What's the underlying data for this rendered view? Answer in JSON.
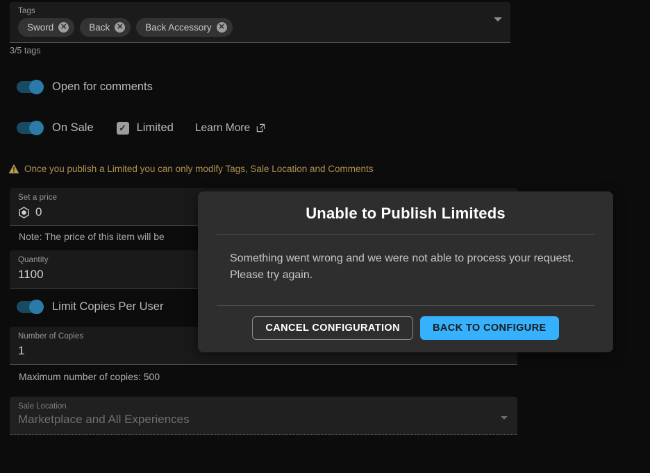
{
  "form": {
    "tags": {
      "label": "Tags",
      "chips": [
        {
          "label": "Sword",
          "remove_icon": "close-circle-icon"
        },
        {
          "label": "Back",
          "remove_icon": "close-circle-icon"
        },
        {
          "label": "Back Accessory",
          "remove_icon": "close-circle-icon"
        }
      ],
      "counter": "3/5 tags",
      "caret_icon": "chevron-down-icon"
    },
    "open_for_comments": {
      "label": "Open for comments",
      "enabled": true
    },
    "on_sale": {
      "label": "On Sale",
      "enabled": true
    },
    "limited": {
      "label": "Limited",
      "checked": true,
      "check_icon": "checkmark-icon"
    },
    "learn_more": {
      "label": "Learn More",
      "icon": "external-link-icon"
    },
    "warning": {
      "icon": "warning-triangle-icon",
      "text": "Once you publish a Limited you can only modify Tags, Sale Location and Comments",
      "color": "#b2914f"
    },
    "price": {
      "label": "Set a price",
      "value": "0",
      "currency_icon": "robux-icon",
      "note": "Note: The price of this item will be"
    },
    "quantity": {
      "label": "Quantity",
      "value": "1100"
    },
    "limit_copies": {
      "label": "Limit Copies Per User",
      "enabled": true
    },
    "number_of_copies": {
      "label": "Number of Copies",
      "value": "1",
      "max_note": "Maximum number of copies: 500"
    },
    "sale_location": {
      "label": "Sale Location",
      "value": "Marketplace and All Experiences",
      "caret_icon": "chevron-down-icon",
      "disabled": true
    }
  },
  "modal": {
    "title": "Unable to Publish Limiteds",
    "message": "Something went wrong and we were not able to process your request. Please try again.",
    "cancel_label": "CANCEL CONFIGURATION",
    "confirm_label": "BACK TO CONFIGURE",
    "accent_color": "#35b1fd"
  }
}
